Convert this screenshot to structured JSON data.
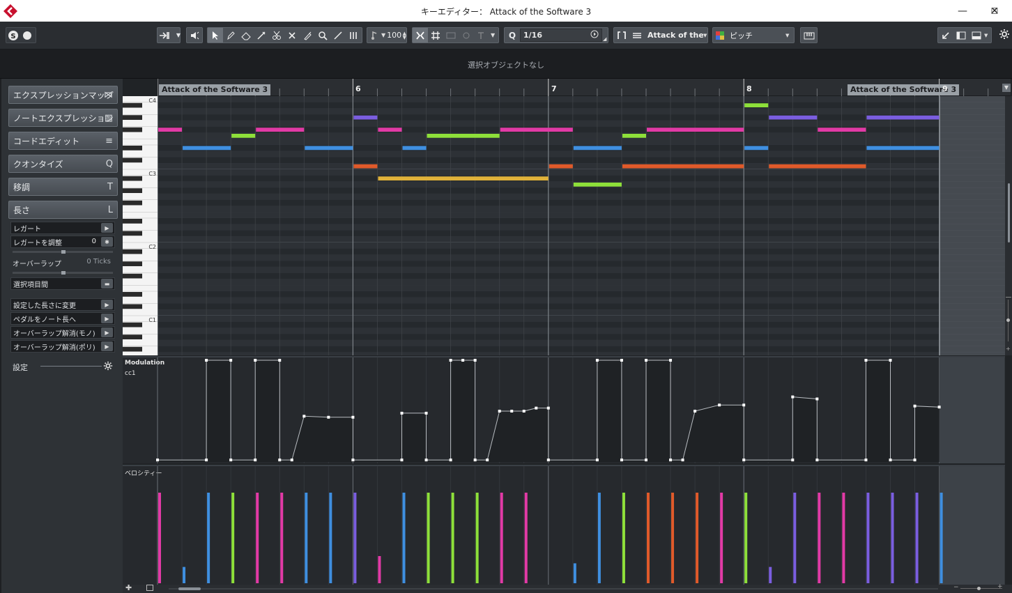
{
  "window": {
    "title": "キーエディター： Attack of the Software 3",
    "minimize": "—",
    "maximize": "☐",
    "close": "✕"
  },
  "toolbar": {
    "velocity_value": "100",
    "quantize_value": "1/16",
    "part_name": "Attack of the S",
    "color_mode": "ピッチ"
  },
  "infoline": {
    "text": "選択オブジェクトなし"
  },
  "inspector": {
    "sections": [
      {
        "label": "エクスプレッションマップ",
        "icon": "⋈"
      },
      {
        "label": "ノートエクスプレッション",
        "icon": "▧"
      },
      {
        "label": "コードエディット",
        "icon": "≡"
      },
      {
        "label": "クオンタイズ",
        "icon": "Q"
      },
      {
        "label": "移調",
        "icon": "T"
      },
      {
        "label": "長さ",
        "icon": "L"
      }
    ],
    "legato": "レガート",
    "legato_adjust": "レガートを調整",
    "legato_adjust_value": "0",
    "overlap": "オーバーラップ",
    "overlap_value": "0 Ticks",
    "selected_range": "選択項目間",
    "set_length": "設定した長さに変更",
    "pedal_to_length": "ペダルをノート長へ",
    "overlap_mono": "オーバーラップ解消(モノ)",
    "overlap_poly": "オーバーラップ解消(ポリ)",
    "settings": "設定"
  },
  "ruler": {
    "bars": [
      "6",
      "7",
      "8",
      "9"
    ],
    "locator_left": "Attack of the Software 3",
    "locator_right": "Attack of the Software 3"
  },
  "keyboard": {
    "labels": [
      "C4",
      "C3",
      "C2",
      "C1"
    ]
  },
  "lanes": {
    "cc_name": "Modulation",
    "cc_sub": "cc1",
    "velocity_name": "ベロシティー"
  },
  "colors": {
    "magenta": "#e23aa6",
    "blue": "#3f8fe0",
    "green": "#8ee03a",
    "purple": "#7b5ee0",
    "orange": "#e05a2a",
    "yellow": "#e0b23a"
  },
  "notes": [
    {
      "start": 0.0,
      "len": 1,
      "pitch": 31,
      "c": "magenta"
    },
    {
      "start": 1.0,
      "len": 2,
      "pitch": 28,
      "c": "blue"
    },
    {
      "start": 3.0,
      "len": 1,
      "pitch": 30,
      "c": "green"
    },
    {
      "start": 4.0,
      "len": 2,
      "pitch": 31,
      "c": "magenta"
    },
    {
      "start": 6.0,
      "len": 2,
      "pitch": 28,
      "c": "blue"
    },
    {
      "start": 8.0,
      "len": 1,
      "pitch": 33,
      "c": "purple"
    },
    {
      "start": 8.0,
      "len": 1,
      "pitch": 25,
      "c": "orange"
    },
    {
      "start": 9.0,
      "len": 1,
      "pitch": 31,
      "c": "magenta"
    },
    {
      "start": 9.0,
      "len": 7,
      "pitch": 23,
      "c": "yellow"
    },
    {
      "start": 10.0,
      "len": 1,
      "pitch": 28,
      "c": "blue"
    },
    {
      "start": 11.0,
      "len": 3,
      "pitch": 30,
      "c": "green"
    },
    {
      "start": 14.0,
      "len": 3,
      "pitch": 31,
      "c": "magenta"
    },
    {
      "start": 16.0,
      "len": 1,
      "pitch": 25,
      "c": "orange"
    },
    {
      "start": 17.0,
      "len": 2,
      "pitch": 28,
      "c": "blue"
    },
    {
      "start": 17.0,
      "len": 2,
      "pitch": 22,
      "c": "green"
    },
    {
      "start": 19.0,
      "len": 1,
      "pitch": 30,
      "c": "green"
    },
    {
      "start": 19.0,
      "len": 5,
      "pitch": 25,
      "c": "orange"
    },
    {
      "start": 20.0,
      "len": 4,
      "pitch": 31,
      "c": "magenta"
    },
    {
      "start": 24.0,
      "len": 1,
      "pitch": 35,
      "c": "green"
    },
    {
      "start": 24.0,
      "len": 1,
      "pitch": 28,
      "c": "blue"
    },
    {
      "start": 25.0,
      "len": 2,
      "pitch": 33,
      "c": "purple"
    },
    {
      "start": 25.0,
      "len": 4,
      "pitch": 25,
      "c": "orange"
    },
    {
      "start": 27.0,
      "len": 2,
      "pitch": 31,
      "c": "magenta"
    },
    {
      "start": 29.0,
      "len": 3,
      "pitch": 33,
      "c": "purple"
    },
    {
      "start": 29.0,
      "len": 3,
      "pitch": 28,
      "c": "blue"
    }
  ],
  "velocities": [
    {
      "t": 0.0,
      "v": 100,
      "c": "magenta"
    },
    {
      "t": 1.0,
      "v": 18,
      "c": "blue"
    },
    {
      "t": 2.0,
      "v": 100,
      "c": "blue"
    },
    {
      "t": 3.0,
      "v": 100,
      "c": "green"
    },
    {
      "t": 4.0,
      "v": 100,
      "c": "magenta"
    },
    {
      "t": 5.0,
      "v": 100,
      "c": "magenta"
    },
    {
      "t": 6.0,
      "v": 100,
      "c": "blue"
    },
    {
      "t": 7.0,
      "v": 100,
      "c": "blue"
    },
    {
      "t": 8.0,
      "v": 100,
      "c": "purple"
    },
    {
      "t": 9.0,
      "v": 30,
      "c": "magenta"
    },
    {
      "t": 10.0,
      "v": 100,
      "c": "blue"
    },
    {
      "t": 11.0,
      "v": 100,
      "c": "green"
    },
    {
      "t": 12.0,
      "v": 100,
      "c": "green"
    },
    {
      "t": 13.0,
      "v": 100,
      "c": "green"
    },
    {
      "t": 14.0,
      "v": 100,
      "c": "magenta"
    },
    {
      "t": 15.0,
      "v": 100,
      "c": "magenta"
    },
    {
      "t": 17.0,
      "v": 22,
      "c": "blue"
    },
    {
      "t": 18.0,
      "v": 100,
      "c": "blue"
    },
    {
      "t": 19.0,
      "v": 100,
      "c": "green"
    },
    {
      "t": 20.0,
      "v": 100,
      "c": "orange"
    },
    {
      "t": 21.0,
      "v": 100,
      "c": "orange"
    },
    {
      "t": 22.0,
      "v": 100,
      "c": "orange"
    },
    {
      "t": 23.0,
      "v": 100,
      "c": "magenta"
    },
    {
      "t": 24.0,
      "v": 100,
      "c": "green"
    },
    {
      "t": 25.0,
      "v": 18,
      "c": "purple"
    },
    {
      "t": 26.0,
      "v": 100,
      "c": "purple"
    },
    {
      "t": 27.0,
      "v": 100,
      "c": "magenta"
    },
    {
      "t": 28.0,
      "v": 100,
      "c": "magenta"
    },
    {
      "t": 29.0,
      "v": 100,
      "c": "purple"
    },
    {
      "t": 30.0,
      "v": 100,
      "c": "purple"
    },
    {
      "t": 31.0,
      "v": 100,
      "c": "purple"
    },
    {
      "t": 32.0,
      "v": 100,
      "c": "blue"
    }
  ],
  "modulation": [
    [
      0.0,
      2
    ],
    [
      2.0,
      2
    ],
    [
      2.0,
      100
    ],
    [
      3.0,
      100
    ],
    [
      3.0,
      2
    ],
    [
      4.0,
      2
    ],
    [
      4.0,
      100
    ],
    [
      5.0,
      100
    ],
    [
      5.0,
      2
    ],
    [
      5.5,
      2
    ],
    [
      6.0,
      45
    ],
    [
      7.0,
      44
    ],
    [
      8.0,
      44
    ],
    [
      8.0,
      2
    ],
    [
      10.0,
      2
    ],
    [
      10.0,
      48
    ],
    [
      11.0,
      48
    ],
    [
      11.0,
      2
    ],
    [
      12.0,
      2
    ],
    [
      12.0,
      100
    ],
    [
      12.5,
      100
    ],
    [
      13.0,
      100
    ],
    [
      13.0,
      2
    ],
    [
      13.5,
      2
    ],
    [
      14.0,
      50
    ],
    [
      14.5,
      50
    ],
    [
      15.0,
      50
    ],
    [
      15.5,
      53
    ],
    [
      16.0,
      53
    ],
    [
      16.0,
      2
    ],
    [
      18.0,
      2
    ],
    [
      18.0,
      100
    ],
    [
      19.0,
      100
    ],
    [
      19.0,
      2
    ],
    [
      20.0,
      2
    ],
    [
      20.0,
      100
    ],
    [
      21.0,
      100
    ],
    [
      21.0,
      2
    ],
    [
      21.5,
      2
    ],
    [
      22.0,
      50
    ],
    [
      23.0,
      56
    ],
    [
      24.0,
      56
    ],
    [
      24.0,
      2
    ],
    [
      26.0,
      2
    ],
    [
      26.0,
      64
    ],
    [
      27.0,
      62
    ],
    [
      27.0,
      2
    ],
    [
      29.0,
      2
    ],
    [
      29.0,
      100
    ],
    [
      30.0,
      100
    ],
    [
      30.0,
      2
    ],
    [
      31.0,
      2
    ],
    [
      31.0,
      55
    ],
    [
      32.0,
      54
    ]
  ]
}
